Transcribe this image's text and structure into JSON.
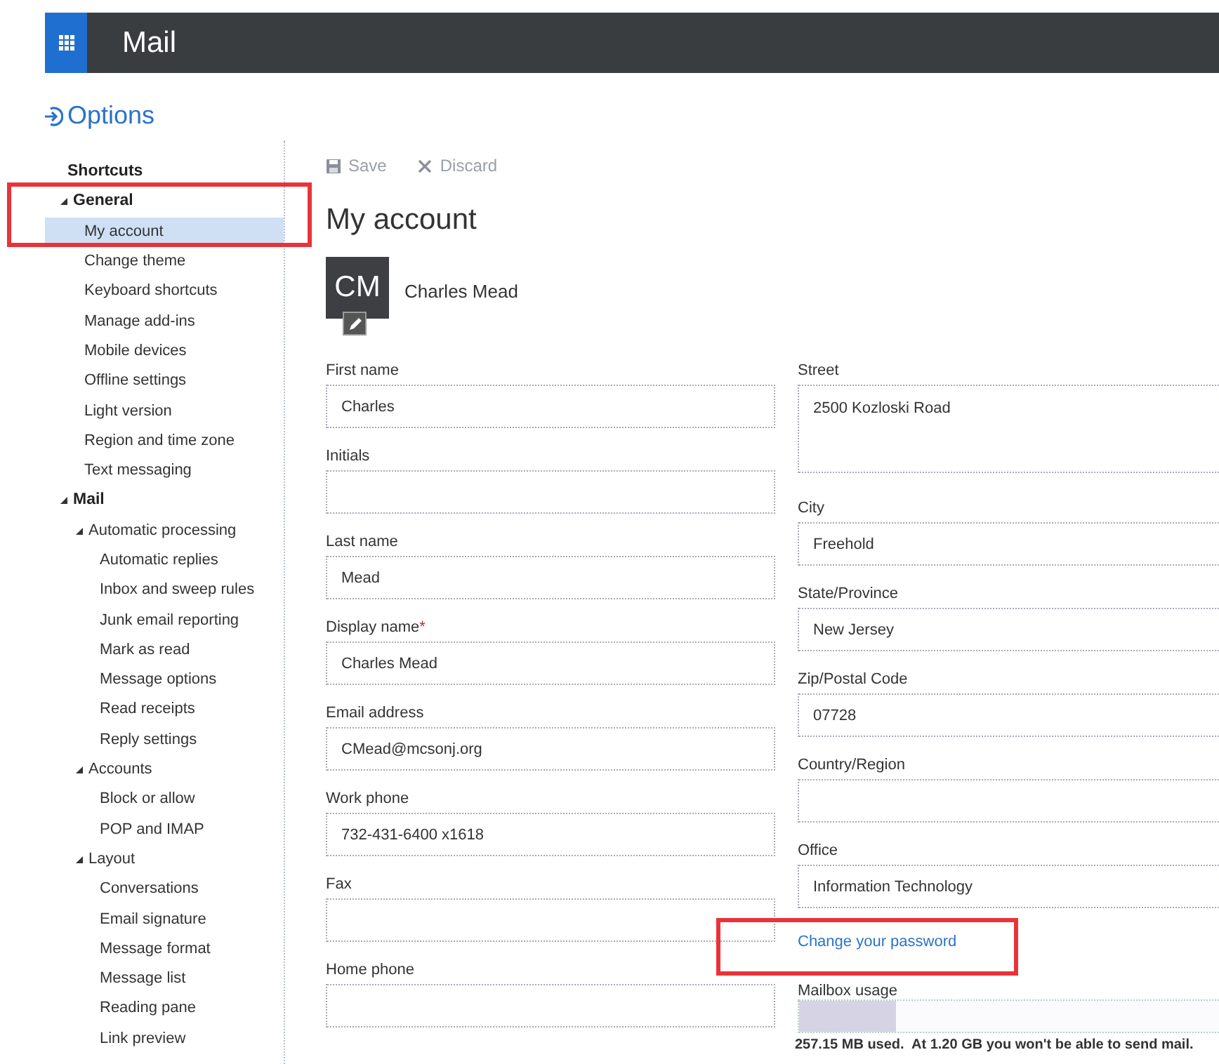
{
  "header": {
    "app_title": "Mail"
  },
  "page_title": "Options",
  "sidebar": {
    "items": [
      {
        "label": "Shortcuts",
        "selected": false
      },
      {
        "label": "General",
        "expanded": true,
        "selected": false,
        "children": [
          {
            "label": "My account",
            "selected": true
          },
          {
            "label": "Change theme",
            "selected": false
          },
          {
            "label": "Keyboard shortcuts",
            "selected": false
          },
          {
            "label": "Manage add-ins",
            "selected": false
          },
          {
            "label": "Mobile devices",
            "selected": false
          },
          {
            "label": "Offline settings",
            "selected": false
          },
          {
            "label": "Light version",
            "selected": false
          },
          {
            "label": "Region and time zone",
            "selected": false
          },
          {
            "label": "Text messaging",
            "selected": false
          }
        ]
      },
      {
        "label": "Mail",
        "expanded": true,
        "selected": false,
        "children": [
          {
            "label": "Automatic processing",
            "expanded": true,
            "selected": false,
            "children": [
              {
                "label": "Automatic replies",
                "selected": false
              },
              {
                "label": "Inbox and sweep rules",
                "selected": false
              },
              {
                "label": "Junk email reporting",
                "selected": false
              },
              {
                "label": "Mark as read",
                "selected": false
              },
              {
                "label": "Message options",
                "selected": false
              },
              {
                "label": "Read receipts",
                "selected": false
              },
              {
                "label": "Reply settings",
                "selected": false
              }
            ]
          },
          {
            "label": "Accounts",
            "expanded": true,
            "selected": false,
            "children": [
              {
                "label": "Block or allow",
                "selected": false
              },
              {
                "label": "POP and IMAP",
                "selected": false
              }
            ]
          },
          {
            "label": "Layout",
            "expanded": true,
            "selected": false,
            "children": [
              {
                "label": "Conversations",
                "selected": false
              },
              {
                "label": "Email signature",
                "selected": false
              },
              {
                "label": "Message format",
                "selected": false
              },
              {
                "label": "Message list",
                "selected": false
              },
              {
                "label": "Reading pane",
                "selected": false
              },
              {
                "label": "Link preview",
                "selected": false
              }
            ]
          }
        ]
      }
    ]
  },
  "toolbar": [
    {
      "kind": "save",
      "label": "Save",
      "disabled": true
    },
    {
      "kind": "discard",
      "label": "Discard",
      "disabled": true
    }
  ],
  "section_title": "My account",
  "profile": {
    "initials": "CM",
    "name": "Charles Mead"
  },
  "left_fields": [
    {
      "label": "First name",
      "value": "Charles"
    },
    {
      "label": "Initials"
    },
    {
      "label": "Last name",
      "value": "Mead"
    },
    {
      "label": "Display name",
      "required_mark": "*",
      "value": "Charles Mead"
    },
    {
      "label": "Email address",
      "value": "CMead@mcsonj.org"
    },
    {
      "label": "Work phone",
      "value": "732-431-6400 x1618"
    },
    {
      "label": "Fax"
    },
    {
      "label": "Home phone"
    }
  ],
  "right_fields": [
    {
      "label": "Street",
      "kind": "multiline",
      "value": "2500 Kozloski Road"
    },
    {
      "label": "City",
      "kind": "line",
      "value": "Freehold"
    },
    {
      "label": "State/Province",
      "kind": "line",
      "value": "New Jersey"
    },
    {
      "label": "Zip/Postal Code",
      "kind": "line",
      "value": "07728"
    },
    {
      "label": "Country/Region",
      "kind": "line"
    },
    {
      "label": "Office",
      "kind": "line",
      "value": "Information Technology"
    }
  ],
  "password_link": "Change your password",
  "mailbox": {
    "label": "Mailbox usage",
    "level": 0.21,
    "note": "257.15 MB used.  At 1.20 GB you won't be able to send mail."
  },
  "annotations": [
    {
      "kind": "frame"
    },
    {
      "kind": "frame"
    }
  ]
}
